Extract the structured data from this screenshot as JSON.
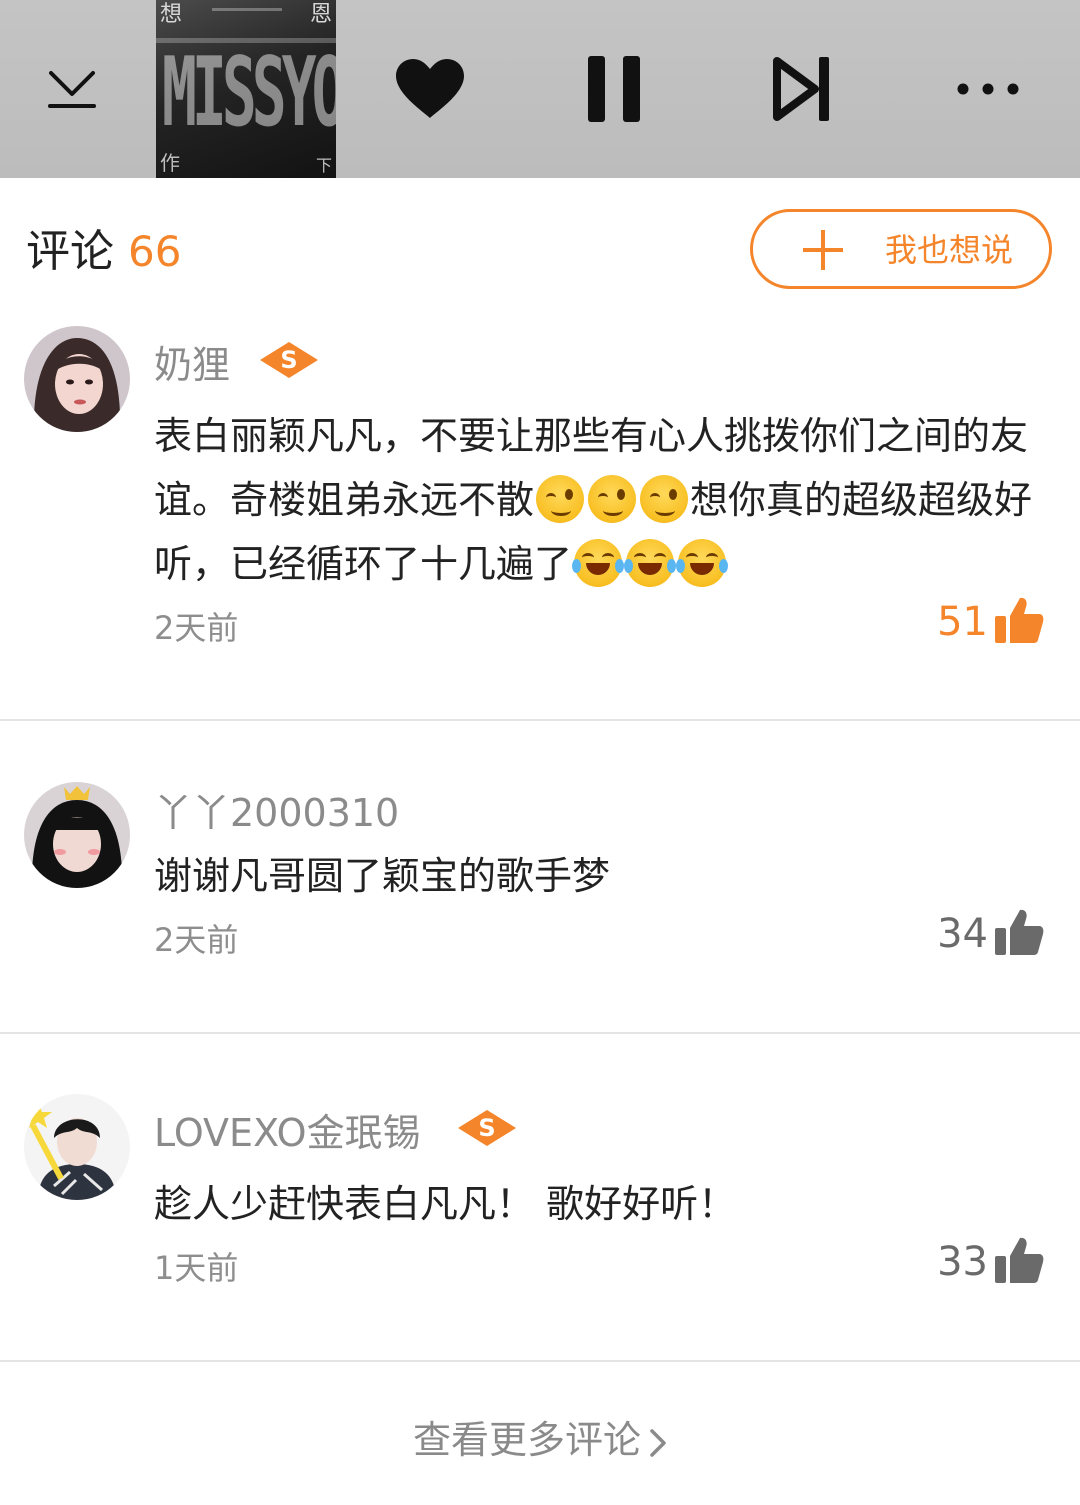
{
  "player": {
    "cover_art_text": {
      "top_left": "想",
      "top_right": "恩",
      "title": "MISSYOU",
      "bottom_left": "作",
      "bottom_right": "下"
    },
    "icons": [
      "collapse-icon",
      "heart-icon",
      "pause-icon",
      "next-track-icon",
      "more-icon"
    ]
  },
  "comments_header": {
    "title": "评论",
    "count": "66",
    "write_button_label": "我也想说"
  },
  "comments": [
    {
      "username": "奶狸",
      "has_badge": true,
      "badge_text": "S",
      "text_segments": [
        "表白丽颖凡凡，不要让那些有心人挑拨你们之间的友谊。奇楼姐弟永远不散",
        "想你真的超级超级好听，已经循环了十几遍了"
      ],
      "time": "2天前",
      "likes": "51",
      "liked": true
    },
    {
      "username": "丫丫2000310",
      "has_badge": false,
      "text_segments": [
        "谢谢凡哥圆了颖宝的歌手梦"
      ],
      "time": "2天前",
      "likes": "34",
      "liked": false
    },
    {
      "username": "LOVEXO金珉锡",
      "has_badge": true,
      "badge_text": "S",
      "text_segments": [
        "趁人少赶快表白凡凡！ 歌好好听！"
      ],
      "time": "1天前",
      "likes": "33",
      "liked": false
    }
  ],
  "footer": {
    "more_label": "查看更多评论"
  },
  "colors": {
    "accent": "#f5852a",
    "liked_count": "#f5852a",
    "unliked_count": "#6a6a6a",
    "muted_text": "#8b8b8b",
    "player_bg": "#c0c0c0",
    "divider": "#e4e4e4"
  }
}
